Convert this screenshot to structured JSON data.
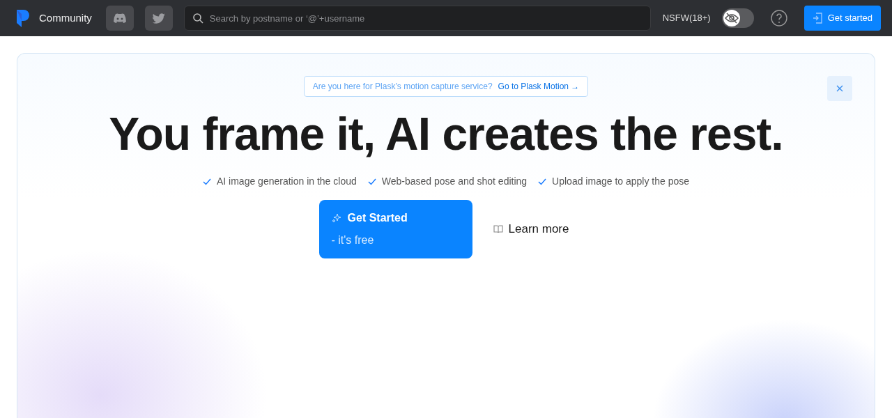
{
  "navbar": {
    "brand": "Community",
    "search": {
      "placeholder": "Search by postname or ‘@’+username"
    },
    "nsfw": {
      "label": "NSFW(18+)",
      "on": false
    },
    "cta": "Get started"
  },
  "hero": {
    "notice": {
      "text": "Are you here for Plask’s motion capture service?",
      "link": "Go to Plask Motion →"
    },
    "title": "You frame it, AI creates the rest.",
    "features": [
      "AI image generation in the cloud",
      "Web-based pose and shot editing",
      "Upload image to apply the pose"
    ],
    "primary": {
      "label": "Get Started",
      "sub": "- it's free"
    },
    "secondary": "Learn more"
  }
}
